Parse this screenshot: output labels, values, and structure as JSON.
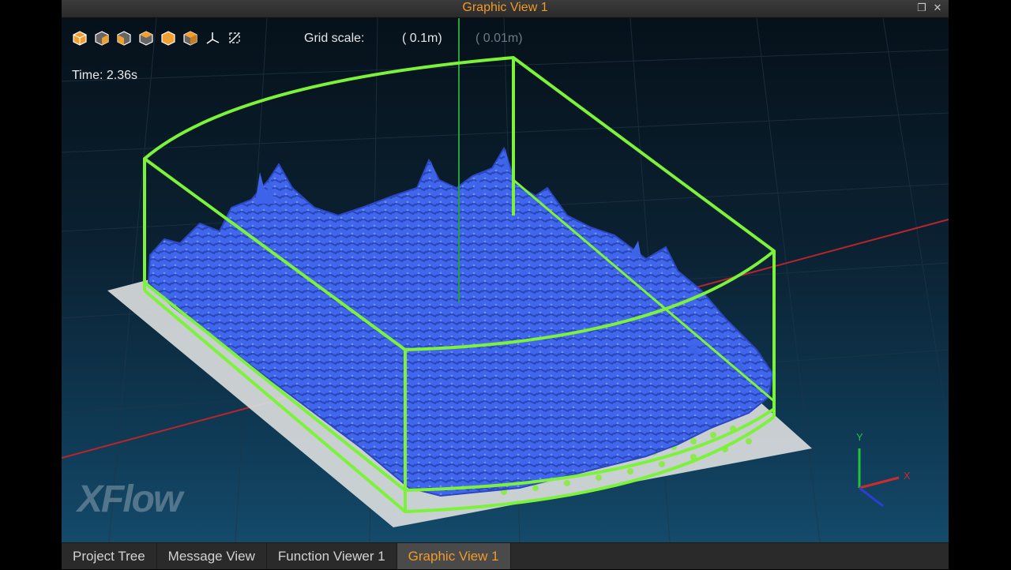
{
  "window": {
    "title": "Graphic View 1"
  },
  "viewport": {
    "grid_scale_label": "Grid scale:",
    "grid_scale_major": "( 0.1m)",
    "grid_scale_minor": "( 0.01m)",
    "time_readout": "Time: 2.36s",
    "logo_text": "XFlow",
    "axes": {
      "y": "Y",
      "x": "X"
    },
    "toolbar": [
      {
        "name": "view-iso-icon"
      },
      {
        "name": "view-front-icon"
      },
      {
        "name": "view-back-icon"
      },
      {
        "name": "view-left-icon"
      },
      {
        "name": "view-right-icon"
      },
      {
        "name": "view-top-icon"
      },
      {
        "name": "axes-icon"
      },
      {
        "name": "fit-view-icon"
      }
    ],
    "colors": {
      "fluid": "#3d63e8",
      "container_outline": "#7cf23a",
      "x_axis_line": "#b8252b",
      "accent": "#f09a2c"
    }
  },
  "tabs": [
    {
      "label": "Project Tree",
      "active": false
    },
    {
      "label": "Message View",
      "active": false
    },
    {
      "label": "Function Viewer 1",
      "active": false
    },
    {
      "label": "Graphic View 1",
      "active": true
    }
  ]
}
